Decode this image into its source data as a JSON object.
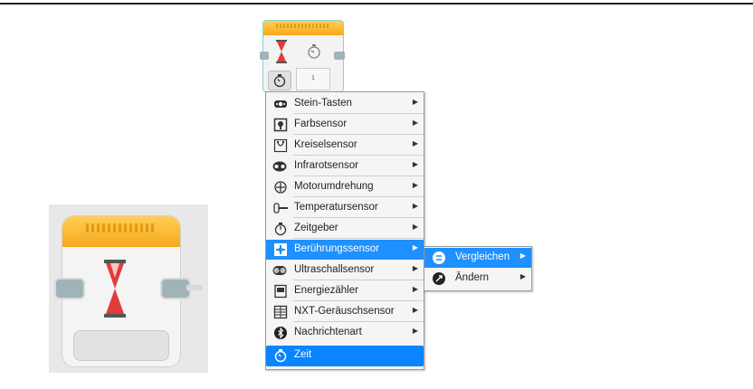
{
  "small_block": {
    "param_value": "1"
  },
  "menu": {
    "items": [
      {
        "label": "Stein-Tasten",
        "icon": "brick-buttons-icon"
      },
      {
        "label": "Farbsensor",
        "icon": "color-sensor-icon"
      },
      {
        "label": "Kreiselsensor",
        "icon": "gyro-sensor-icon"
      },
      {
        "label": "Infrarotsensor",
        "icon": "infrared-sensor-icon"
      },
      {
        "label": "Motorumdrehung",
        "icon": "motor-rotation-icon"
      },
      {
        "label": "Temperatursensor",
        "icon": "temperature-sensor-icon"
      },
      {
        "label": "Zeitgeber",
        "icon": "timer-icon"
      },
      {
        "label": "Berührungssensor",
        "icon": "touch-sensor-icon",
        "highlighted": true
      },
      {
        "label": "Ultraschallsensor",
        "icon": "ultrasonic-sensor-icon"
      },
      {
        "label": "Energiezähler",
        "icon": "energy-meter-icon"
      },
      {
        "label": "NXT-Geräuschsensor",
        "icon": "nxt-sound-sensor-icon"
      },
      {
        "label": "Nachrichtenart",
        "icon": "messaging-icon"
      },
      {
        "label": "Zeit",
        "icon": "time-icon",
        "selected": true
      }
    ],
    "arrow": "▶"
  },
  "submenu": {
    "items": [
      {
        "label": "Vergleichen",
        "icon": "compare-icon",
        "highlighted": true
      },
      {
        "label": "Ändern",
        "icon": "change-icon"
      }
    ]
  },
  "colors": {
    "highlight": "#1e90ff",
    "block_header": "#f6a81c",
    "selection_border": "#7fd6dc"
  }
}
